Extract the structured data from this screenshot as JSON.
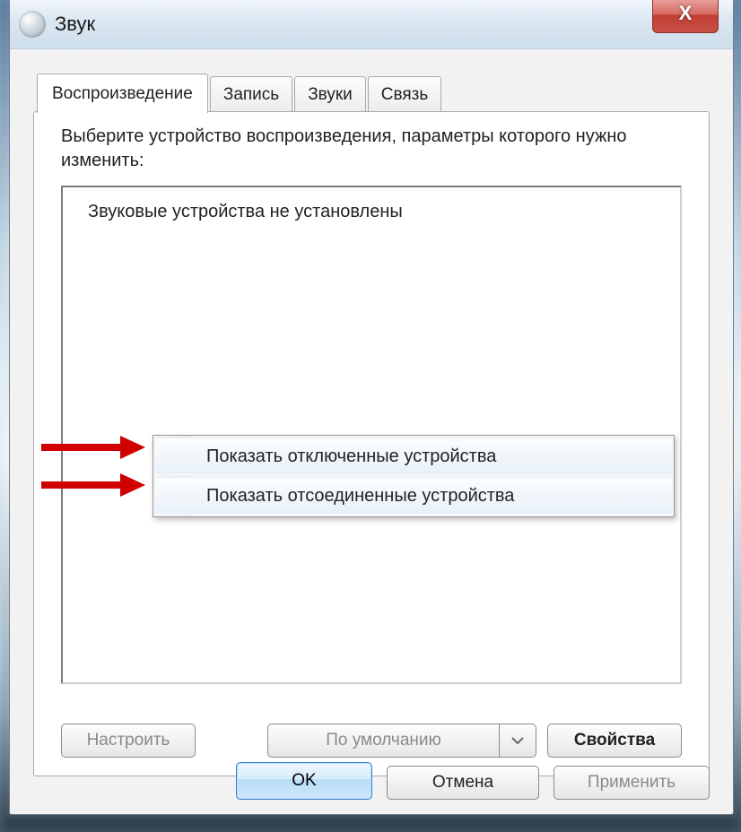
{
  "window": {
    "title": "Звук",
    "close_glyph": "X"
  },
  "tabs": {
    "playback": "Воспроизведение",
    "recording": "Запись",
    "sounds": "Звуки",
    "comm": "Связь"
  },
  "panel": {
    "instruction": "Выберите устройство воспроизведения, параметры которого нужно изменить:",
    "empty_msg": "Звуковые устройства не установлены"
  },
  "context_menu": {
    "show_disabled": "Показать отключенные устройства",
    "show_disconnected": "Показать отсоединенные устройства"
  },
  "panel_buttons": {
    "configure": "Настроить",
    "set_default": "По умолчанию",
    "properties": "Свойства"
  },
  "dialog_buttons": {
    "ok": "OK",
    "cancel": "Отмена",
    "apply": "Применить"
  }
}
